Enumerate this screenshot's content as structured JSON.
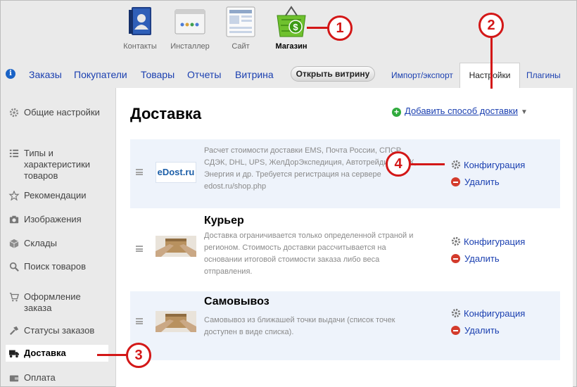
{
  "apps": [
    {
      "label": "Контакты",
      "icon": "contacts-icon"
    },
    {
      "label": "Инсталлер",
      "icon": "installer-icon"
    },
    {
      "label": "Сайт",
      "icon": "site-icon"
    },
    {
      "label": "Магазин",
      "icon": "shop-icon"
    }
  ],
  "nav": {
    "items": [
      "Заказы",
      "Покупатели",
      "Товары",
      "Отчеты",
      "Витрина"
    ],
    "open_store": "Открыть витрину",
    "import_export": "Импорт/экспорт",
    "settings": "Настройки",
    "plugins": "Плагины"
  },
  "sidebar": [
    {
      "label": "Общие настройки",
      "icon": "gear-icon"
    },
    {
      "label": "Типы и характеристики товаров",
      "icon": "list-icon"
    },
    {
      "label": "Рекомендации",
      "icon": "star-icon"
    },
    {
      "label": "Изображения",
      "icon": "camera-icon"
    },
    {
      "label": "Склады",
      "icon": "box-icon"
    },
    {
      "label": "Поиск товаров",
      "icon": "search-icon"
    },
    {
      "label": "Оформление заказа",
      "icon": "cart-icon"
    },
    {
      "label": "Статусы заказов",
      "icon": "hammer-icon"
    },
    {
      "label": "Доставка",
      "icon": "truck-icon"
    },
    {
      "label": "Оплата",
      "icon": "wallet-icon"
    }
  ],
  "main": {
    "title": "Доставка",
    "add_method": "Добавить способ доставки",
    "config_label": "Конфигурация",
    "delete_label": "Удалить",
    "methods": [
      {
        "name": "",
        "logo_text": "eDost.ru",
        "desc": [
          "Расчет стоимости доставки EMS, Почта России, СПСР,",
          "СДЭК, DHL, UPS, ЖелДорЭкспедиция, Автотрейдинг, ПЭК,",
          "Энергия и др. Требуется регистрация на сервере",
          "edost.ru/shop.php"
        ]
      },
      {
        "name": "Курьер",
        "desc": [
          "Доставка ограничивается только определенной страной и",
          "регионом. Стоимость доставки рассчитывается на",
          "основании итоговой стоимости заказа либо веса",
          "отправления."
        ]
      },
      {
        "name": "Самовывоз",
        "desc": [
          "Самовывоз из ближашей точки выдачи (список точек",
          "доступен в виде списка)."
        ]
      }
    ]
  },
  "callouts": [
    "1",
    "2",
    "3",
    "4"
  ],
  "colors": {
    "accent": "#1a3fb0",
    "callout": "#d31717",
    "row_shade": "#eef3fb"
  }
}
